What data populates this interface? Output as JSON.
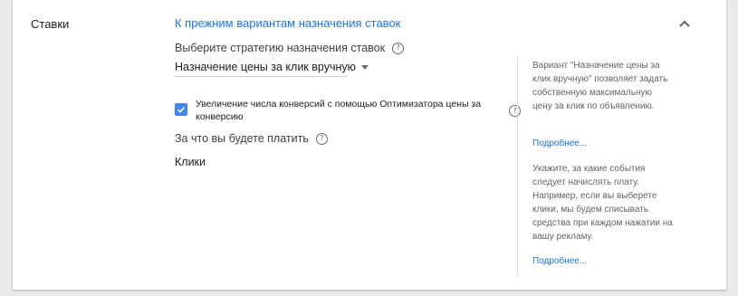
{
  "section": {
    "title": "Ставки",
    "back_link": "К прежним вариантам назначения ставок"
  },
  "strategy": {
    "label": "Выберите стратегию назначения ставок",
    "selected": "Назначение цены за клик вручную"
  },
  "enhanced_cpc": {
    "checked": true,
    "label": "Увеличение числа конверсий с помощью Оптимизатора цены за конверсию"
  },
  "payment": {
    "label": "За что вы будете платить",
    "value": "Клики"
  },
  "help_panel": {
    "strategy_help": "Вариант \"Назначение цены за клик вручную\" позволяет задать собственную максимальную цену за клик по объявлению.",
    "strategy_link": "Подробнее...",
    "payment_help": "Укажите, за какие события следует начислять плату. Например, если вы выберете клики, мы будем списывать средства при каждом нажатии на вашу рекламу.",
    "payment_link": "Подробнее..."
  },
  "icons": {
    "help": "help-circle-icon",
    "collapse": "chevron-up-icon",
    "checkbox": "checkmark-icon",
    "dropdown": "caret-down-icon"
  },
  "colors": {
    "link": "#1a73e8",
    "checkbox": "#4285f4"
  }
}
